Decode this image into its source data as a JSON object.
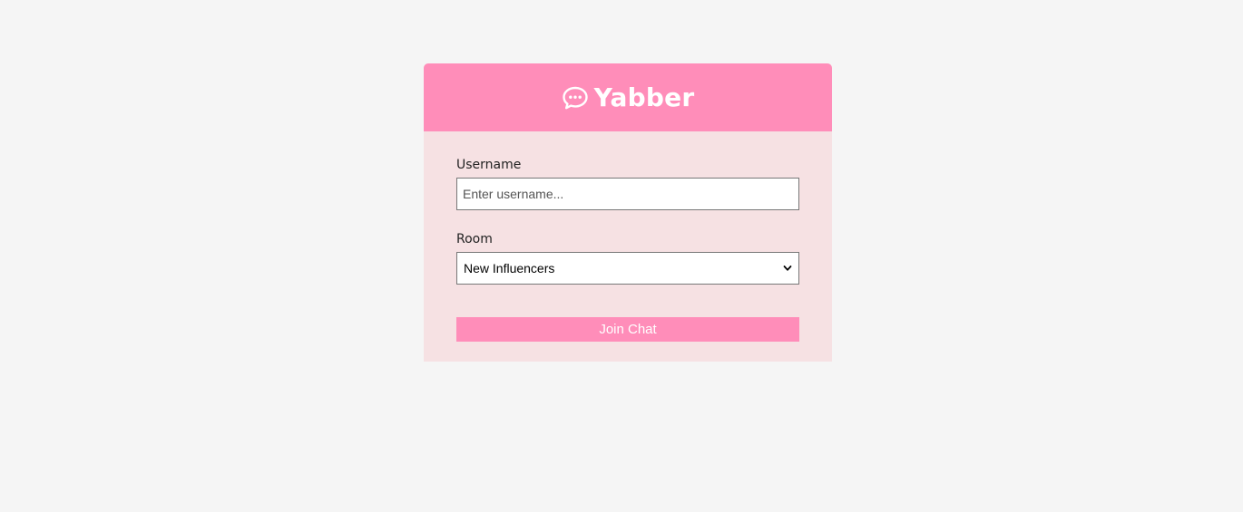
{
  "header": {
    "title": "Yabber",
    "icon": "chat-bubble-icon",
    "background_color": "#ff8db9"
  },
  "form": {
    "username_label": "Username",
    "username_placeholder": "Enter username...",
    "username_value": "",
    "room_label": "Room",
    "room_selected": "New Influencers",
    "join_button_label": "Join Chat"
  },
  "colors": {
    "accent": "#ff8db9",
    "card_body": "#f6e1e3",
    "page_background": "#f5f5f5"
  }
}
